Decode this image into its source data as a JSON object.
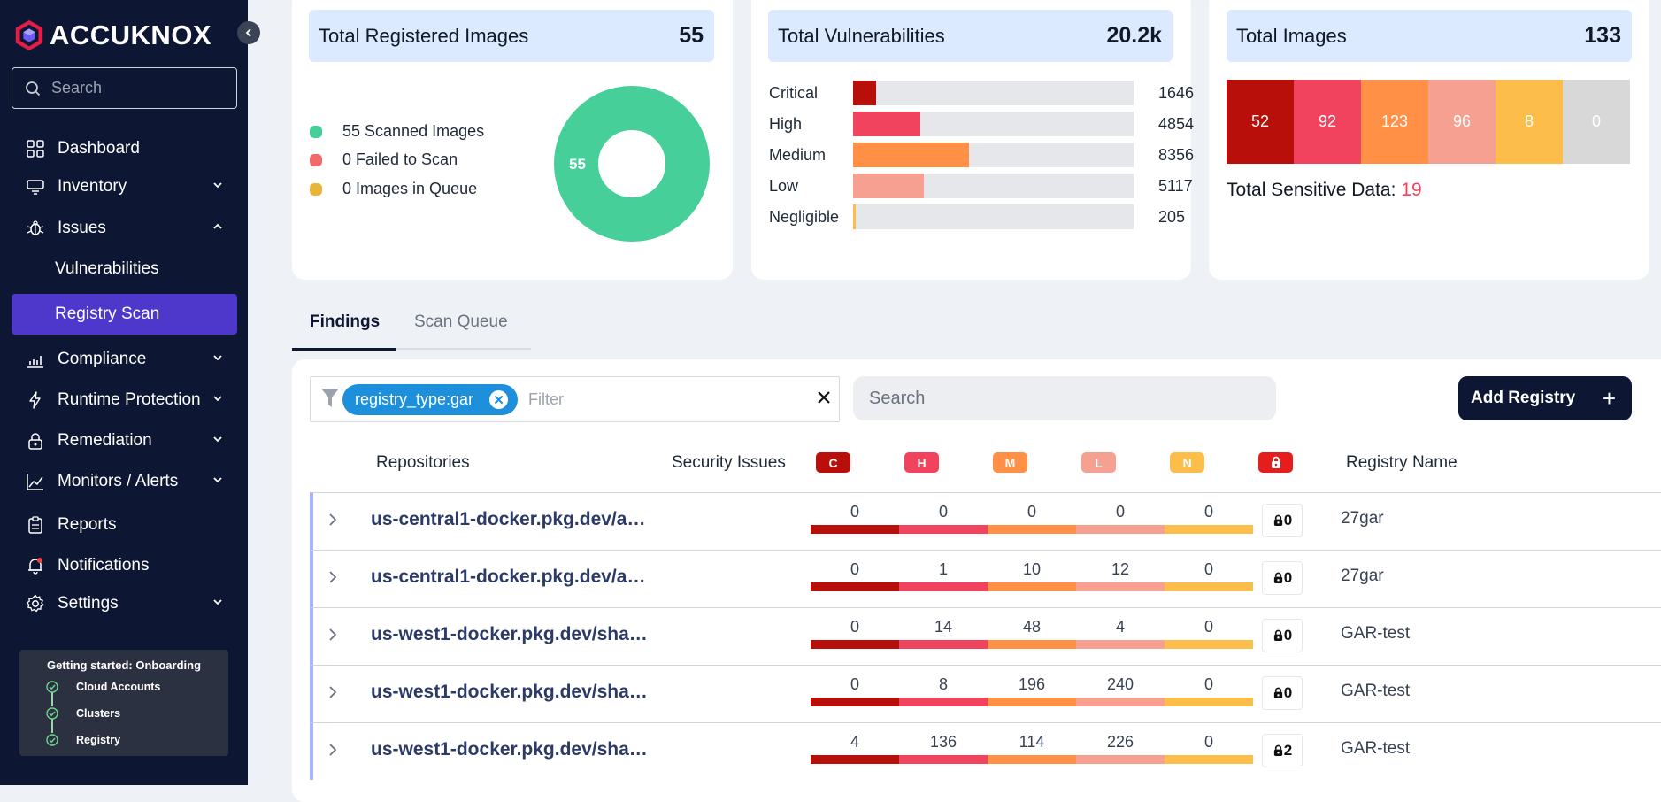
{
  "brand": {
    "name": "ACCUKNOX"
  },
  "sidebar": {
    "search_placeholder": "Search",
    "items": [
      {
        "label": "Dashboard",
        "icon": "dashboard-icon"
      },
      {
        "label": "Inventory",
        "icon": "inventory-icon",
        "expandable": true
      },
      {
        "label": "Issues",
        "icon": "bug-icon",
        "expanded": true
      },
      {
        "label": "Compliance",
        "icon": "compliance-icon",
        "expandable": true
      },
      {
        "label": "Runtime Protection",
        "icon": "bolt-icon",
        "expandable": true
      },
      {
        "label": "Remediation",
        "icon": "lock-icon",
        "expandable": true
      },
      {
        "label": "Monitors / Alerts",
        "icon": "chart-line-icon",
        "expandable": true
      },
      {
        "label": "Reports",
        "icon": "clipboard-icon"
      },
      {
        "label": "Notifications",
        "icon": "bell-icon"
      },
      {
        "label": "Settings",
        "icon": "gear-icon",
        "expandable": true
      }
    ],
    "sub_items": [
      {
        "label": "Vulnerabilities"
      },
      {
        "label": "Registry Scan",
        "active": true
      }
    ],
    "onboarding": {
      "title": "Getting started: Onboarding",
      "steps": [
        "Cloud Accounts",
        "Clusters",
        "Registry"
      ]
    }
  },
  "cards": {
    "registered": {
      "title": "Total Registered Images",
      "value": "55",
      "legend": [
        {
          "label": "55 Scanned Images",
          "color": "#47cf9a"
        },
        {
          "label": "0 Failed to Scan",
          "color": "#f26b6b"
        },
        {
          "label": "0 Images in Queue",
          "color": "#e9b43a"
        }
      ],
      "donut_label": "55"
    },
    "vulnerabilities": {
      "title": "Total Vulnerabilities",
      "value": "20.2k",
      "rows": [
        {
          "label": "Critical",
          "value": 1646,
          "color": "#b80f0a"
        },
        {
          "label": "High",
          "value": 4854,
          "color": "#f2435e"
        },
        {
          "label": "Medium",
          "value": 8356,
          "color": "#ff9046"
        },
        {
          "label": "Low",
          "value": 5117,
          "color": "#f5a091"
        },
        {
          "label": "Negligible",
          "value": 205,
          "color": "#fdbd4a"
        }
      ],
      "max": 20200
    },
    "images": {
      "title": "Total Images",
      "value": "133",
      "severity": [
        {
          "value": "52",
          "color": "#b80f0a"
        },
        {
          "value": "92",
          "color": "#f2435e"
        },
        {
          "value": "123",
          "color": "#ff9046"
        },
        {
          "value": "96",
          "color": "#f5a091"
        },
        {
          "value": "8",
          "color": "#fdbd4a"
        },
        {
          "value": "0",
          "color": "#d8d8d8"
        }
      ],
      "sensitive_label": "Total Sensitive Data:",
      "sensitive_value": "19"
    }
  },
  "tabs": [
    {
      "label": "Findings",
      "active": true
    },
    {
      "label": "Scan Queue",
      "active": false
    }
  ],
  "toolbar": {
    "filter_chip": "registry_type:gar",
    "filter_placeholder": "Filter",
    "search_placeholder": "Search",
    "add_label": "Add Registry"
  },
  "table": {
    "headers": {
      "repositories": "Repositories",
      "security_issues": "Security Issues",
      "registry_name": "Registry Name"
    },
    "severity_badges": [
      {
        "label": "C",
        "color": "#b80f0a"
      },
      {
        "label": "H",
        "color": "#f2435e"
      },
      {
        "label": "M",
        "color": "#ff9046"
      },
      {
        "label": "L",
        "color": "#f5a091"
      },
      {
        "label": "N",
        "color": "#fdbd4a"
      }
    ],
    "secret_badge_color": "#e51d1d",
    "rows": [
      {
        "repo": "us-central1-docker.pkg.dev/a…",
        "counts": [
          "0",
          "0",
          "0",
          "0",
          "0"
        ],
        "secrets": "0",
        "registry": "27gar"
      },
      {
        "repo": "us-central1-docker.pkg.dev/a…",
        "counts": [
          "0",
          "1",
          "10",
          "12",
          "0"
        ],
        "secrets": "0",
        "registry": "27gar"
      },
      {
        "repo": "us-west1-docker.pkg.dev/sha…",
        "counts": [
          "0",
          "14",
          "48",
          "4",
          "0"
        ],
        "secrets": "0",
        "registry": "GAR-test"
      },
      {
        "repo": "us-west1-docker.pkg.dev/sha…",
        "counts": [
          "0",
          "8",
          "196",
          "240",
          "0"
        ],
        "secrets": "0",
        "registry": "GAR-test"
      },
      {
        "repo": "us-west1-docker.pkg.dev/sha…",
        "counts": [
          "4",
          "136",
          "114",
          "226",
          "0"
        ],
        "secrets": "2",
        "registry": "GAR-test"
      }
    ]
  }
}
